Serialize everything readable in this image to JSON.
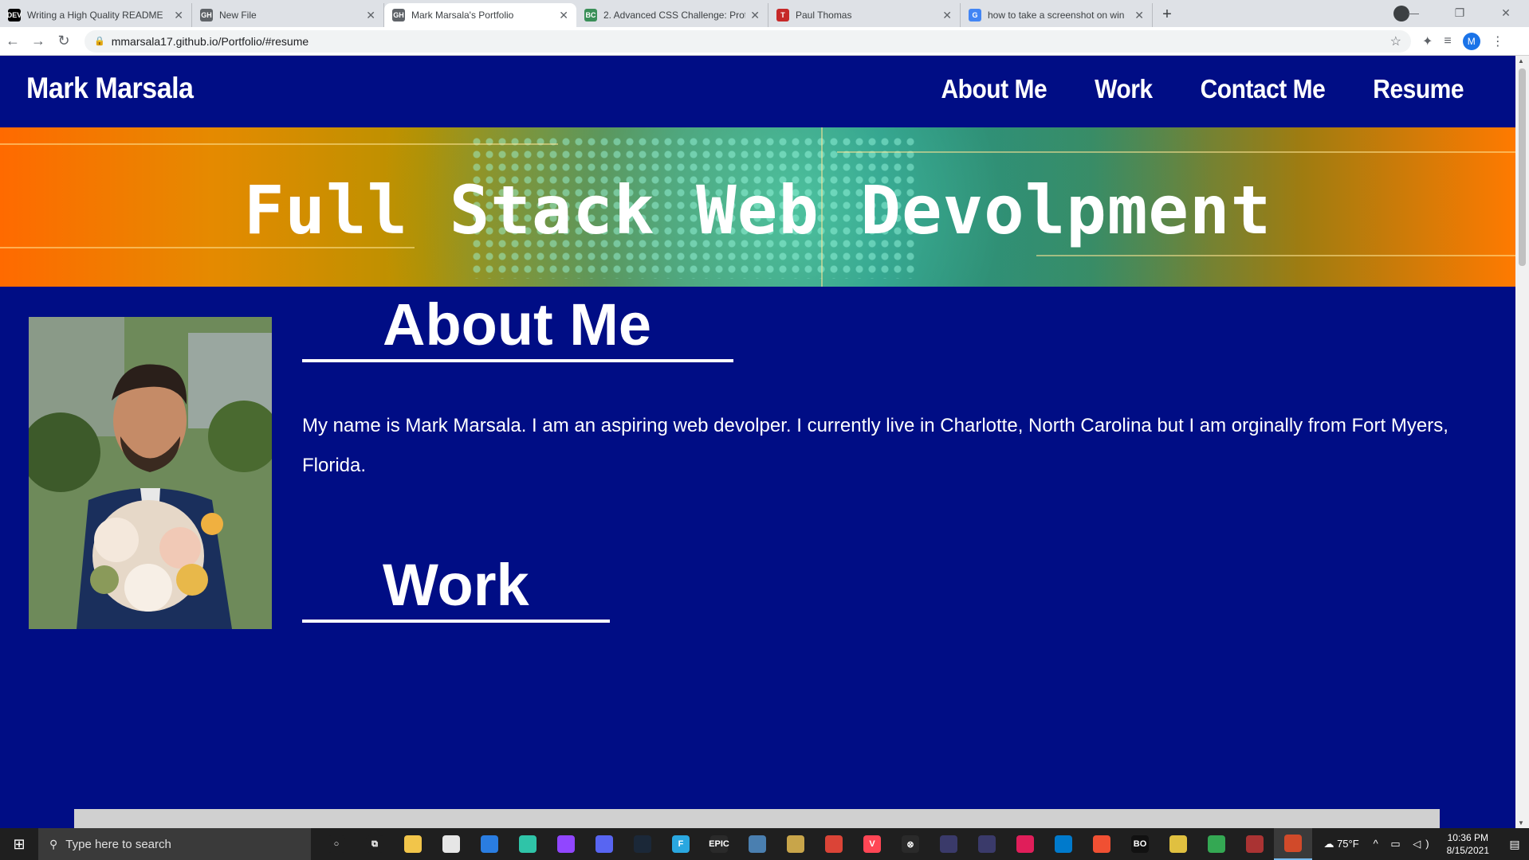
{
  "browser": {
    "tabs": [
      {
        "title": "Writing a High Quality README",
        "favicon": "DEV",
        "color": "#000000",
        "active": false
      },
      {
        "title": "New File",
        "favicon": "GH",
        "color": "#5f6368",
        "active": false
      },
      {
        "title": "Mark Marsala's Portfolio",
        "favicon": "GH",
        "color": "#5f6368",
        "active": true
      },
      {
        "title": "2. Advanced CSS Challenge: Prof",
        "favicon": "BC",
        "color": "#3a8f58",
        "active": false
      },
      {
        "title": "Paul Thomas",
        "favicon": "T",
        "color": "#c62828",
        "active": false
      },
      {
        "title": "how to take a screenshot on win",
        "favicon": "G",
        "color": "#4285f4",
        "active": false
      }
    ],
    "url": "mmarsala17.github.io/Portfolio/#resume",
    "profile_initial": "M"
  },
  "site": {
    "brand": "Mark Marsala",
    "nav": [
      "About Me",
      "Work",
      "Contact Me",
      "Resume"
    ],
    "hero_title": "Full Stack Web Devolpment",
    "about_title": "About Me",
    "about_text": "My name is Mark Marsala. I am an aspiring web devolper. I currently live in Charlotte, North Carolina but I am orginally from Fort Myers, Florida.",
    "work_title": "Work"
  },
  "taskbar": {
    "search_placeholder": "Type here to search",
    "apps": [
      {
        "name": "cortana-icon",
        "color": "#1f1f1f",
        "glyph": "○"
      },
      {
        "name": "task-view-icon",
        "color": "#1f1f1f",
        "glyph": "⧉"
      },
      {
        "name": "file-explorer-icon",
        "color": "#f2c54a",
        "glyph": ""
      },
      {
        "name": "store-icon",
        "color": "#e6e6e6",
        "glyph": ""
      },
      {
        "name": "mail-icon",
        "color": "#2a7de1",
        "glyph": ""
      },
      {
        "name": "app-green-icon",
        "color": "#2fc4a8",
        "glyph": ""
      },
      {
        "name": "twitch-icon",
        "color": "#9146ff",
        "glyph": ""
      },
      {
        "name": "discord-icon",
        "color": "#5865f2",
        "glyph": ""
      },
      {
        "name": "steam-icon",
        "color": "#1b2838",
        "glyph": ""
      },
      {
        "name": "fortnite-icon",
        "color": "#2aa7e0",
        "glyph": "F"
      },
      {
        "name": "epic-games-icon",
        "color": "#2a2a2a",
        "glyph": "EPIC"
      },
      {
        "name": "shield-app-icon",
        "color": "#4a7fb0",
        "glyph": ""
      },
      {
        "name": "league-icon",
        "color": "#c8a54a",
        "glyph": ""
      },
      {
        "name": "chrome-icon",
        "color": "#db4437",
        "glyph": ""
      },
      {
        "name": "valorant-icon",
        "color": "#ff4655",
        "glyph": "V"
      },
      {
        "name": "xbox-icon",
        "color": "#2a2a2a",
        "glyph": "⊗"
      },
      {
        "name": "vpn-icon",
        "color": "#3a3a6a",
        "glyph": ""
      },
      {
        "name": "nordvpn-icon",
        "color": "#3a3a6a",
        "glyph": ""
      },
      {
        "name": "slack-icon",
        "color": "#e01e5a",
        "glyph": ""
      },
      {
        "name": "vscode-icon",
        "color": "#007acc",
        "glyph": ""
      },
      {
        "name": "git-icon",
        "color": "#f05033",
        "glyph": ""
      },
      {
        "name": "black-ops-icon",
        "color": "#111111",
        "glyph": "BO"
      },
      {
        "name": "app-diamond-icon",
        "color": "#e0c040",
        "glyph": ""
      },
      {
        "name": "chrome-profile-icon",
        "color": "#34a853",
        "glyph": ""
      },
      {
        "name": "sandbox-icon",
        "color": "#aa3333",
        "glyph": ""
      },
      {
        "name": "paint-icon",
        "color": "#d14a2a",
        "glyph": ""
      }
    ],
    "temperature": "75°F",
    "time": "10:36 PM",
    "date": "8/15/2021"
  }
}
